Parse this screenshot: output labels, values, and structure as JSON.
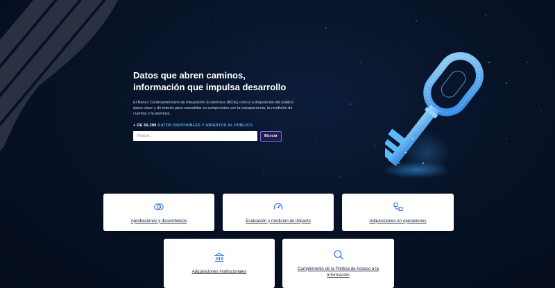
{
  "hero": {
    "headline_line1": "Datos que abren caminos,",
    "headline_line2": "información que impulsa desarrollo",
    "intro": "El Banco Centroamericano de Integración Económica (BCIE) coloca a disposición del público datos clave y de interés para consolidar su compromiso con la transparencia, la rendición de cuentas y la apertura.",
    "counter_value": "+ DE 56,289",
    "counter_label": "DATOS DISPONIBLES Y ABIERTOS AL PÚBLICO"
  },
  "search": {
    "placeholder": "Buscar...",
    "button_label": "Buscar"
  },
  "cards": [
    {
      "label": "Aprobaciones y desembolsos",
      "icon": "coins-icon"
    },
    {
      "label": "Evaluación y medición de impacto",
      "icon": "gauge-icon"
    },
    {
      "label": "Adquisiciones en operaciones",
      "icon": "flow-icon"
    },
    {
      "label": "Adquisiciones institucionales",
      "icon": "institution-icon"
    },
    {
      "label": "Cumplimiento de la Política de Acceso a la Información",
      "icon": "search-icon"
    }
  ],
  "colors": {
    "background": "#071327",
    "accent_blue": "#55b3f2",
    "icon_blue": "#2a6fd6",
    "button_bg": "#231a4c",
    "button_border": "#7d6ee8"
  }
}
